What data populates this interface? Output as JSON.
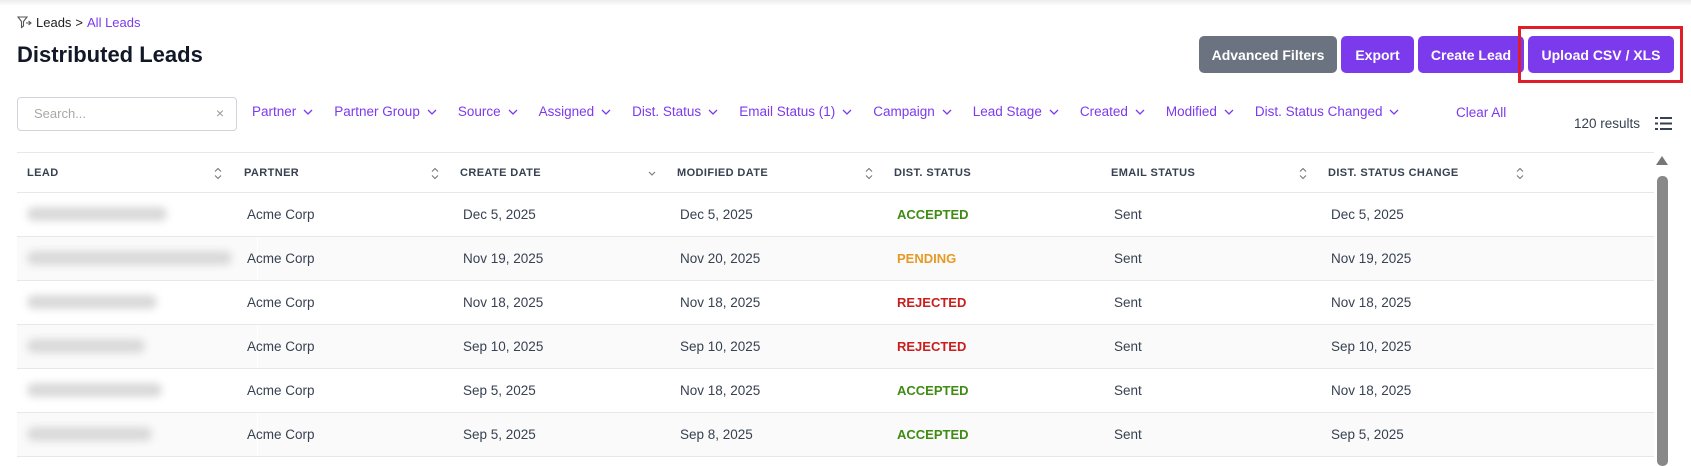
{
  "breadcrumb": {
    "icon": "funnel-icon",
    "root": "Leads",
    "separator": ">",
    "current": "All Leads"
  },
  "page_title": "Distributed Leads",
  "actions": {
    "advanced_filters": "Advanced Filters",
    "export": "Export",
    "create_lead": "Create Lead",
    "upload": "Upload CSV / XLS"
  },
  "search": {
    "placeholder": "Search...",
    "clear_icon": "×"
  },
  "filters": [
    "Partner",
    "Partner Group",
    "Source",
    "Assigned",
    "Dist. Status",
    "Email Status (1)",
    "Campaign",
    "Lead Stage",
    "Created",
    "Modified",
    "Dist. Status Changed"
  ],
  "clear_all": "Clear All",
  "results": "120 results",
  "table": {
    "columns": [
      "LEAD",
      "PARTNER",
      "CREATE DATE",
      "MODIFIED DATE",
      "DIST. STATUS",
      "EMAIL STATUS",
      "DIST. STATUS CHANGE"
    ],
    "rows": [
      {
        "partner": "Acme Corp",
        "create_date": "Dec 5, 2025",
        "modified_date": "Dec 5, 2025",
        "dist_status": "ACCEPTED",
        "email_status": "Sent",
        "status_change": "Dec 5, 2025"
      },
      {
        "partner": "Acme Corp",
        "create_date": "Nov 19, 2025",
        "modified_date": "Nov 20, 2025",
        "dist_status": "PENDING",
        "email_status": "Sent",
        "status_change": "Nov 19, 2025"
      },
      {
        "partner": "Acme Corp",
        "create_date": "Nov 18, 2025",
        "modified_date": "Nov 18, 2025",
        "dist_status": "REJECTED",
        "email_status": "Sent",
        "status_change": "Nov 18, 2025"
      },
      {
        "partner": "Acme Corp",
        "create_date": "Sep 10, 2025",
        "modified_date": "Sep 10, 2025",
        "dist_status": "REJECTED",
        "email_status": "Sent",
        "status_change": "Sep 10, 2025"
      },
      {
        "partner": "Acme Corp",
        "create_date": "Sep 5, 2025",
        "modified_date": "Nov 18, 2025",
        "dist_status": "ACCEPTED",
        "email_status": "Sent",
        "status_change": "Nov 18, 2025"
      },
      {
        "partner": "Acme Corp",
        "create_date": "Sep 5, 2025",
        "modified_date": "Sep 8, 2025",
        "dist_status": "ACCEPTED",
        "email_status": "Sent",
        "status_change": "Sep 5, 2025"
      }
    ]
  },
  "colors": {
    "accent": "#7c3aed",
    "gray_button": "#6b7280",
    "accepted": "#3f8b14",
    "pending": "#e69a24",
    "rejected": "#c81e1e",
    "highlight": "#e11d2a"
  }
}
